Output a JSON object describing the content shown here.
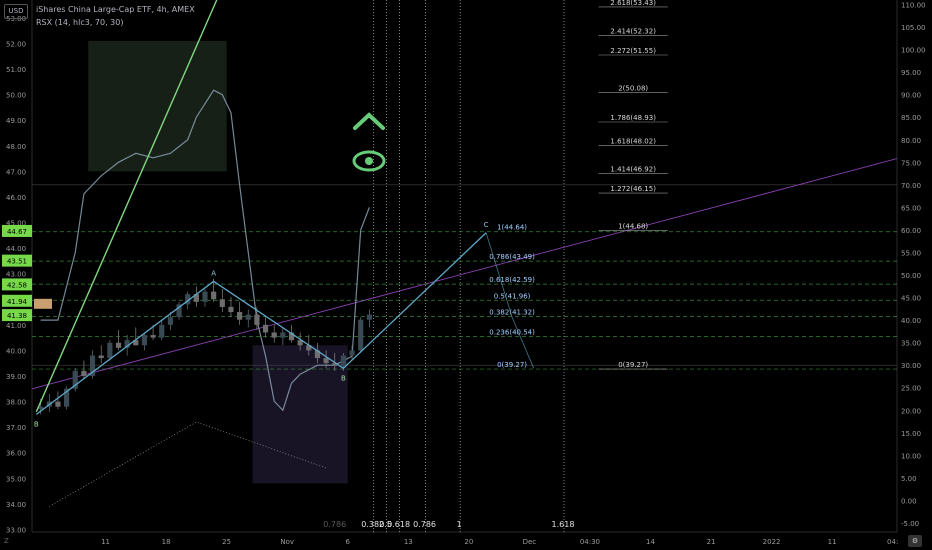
{
  "header": {
    "title": "iShares China Large-Cap ETF, 4h, AMEX",
    "indicator": "RSX (14, hlc3, 70, 30)",
    "currency": "USD"
  },
  "corner": {
    "zoom_label": "Z",
    "settings_icon": "gear-icon"
  },
  "colors": {
    "background": "#000000",
    "candle_up": "#3a4a55",
    "candle_down": "#6e6e6e",
    "trend_line": "#7fd87f",
    "wave": "#5fa8c8",
    "fib": "#3fa83f",
    "channel": "#8a3fb0",
    "rsx": "#8aa0b0",
    "badge": "#76d94a",
    "price_badge": "#c8a070"
  },
  "chart_data": {
    "type": "candlestick",
    "price_axis": {
      "ticks": [
        "53.00",
        "52.00",
        "51.00",
        "50.00",
        "49.00",
        "48.00",
        "47.00",
        "46.00",
        "45.00",
        "44.00",
        "43.00",
        "42.00",
        "41.00",
        "40.00",
        "39.00",
        "38.00",
        "37.00",
        "36.00",
        "35.00",
        "34.00",
        "33.00"
      ],
      "range": [
        32.9,
        53.7
      ]
    },
    "price_badges": [
      {
        "label": "44.67",
        "value": 44.67
      },
      {
        "label": "43.51",
        "value": 43.51
      },
      {
        "label": "42.58",
        "value": 42.58
      },
      {
        "label": "41.94",
        "value": 41.94
      },
      {
        "label": "41.38",
        "value": 41.38
      }
    ],
    "rsx_axis": {
      "ticks": [
        "110.00",
        "105.00",
        "100.00",
        "95.00",
        "90.00",
        "85.00",
        "80.00",
        "75.00",
        "70.00",
        "65.00",
        "60.00",
        "55.00",
        "50.00",
        "45.00",
        "40.00",
        "35.00",
        "30.00",
        "25.00",
        "20.00",
        "15.00",
        "10.00",
        "5.00",
        "0.00",
        "-5.00"
      ],
      "range": [
        -7,
        111
      ]
    },
    "time_axis": {
      "labels": [
        {
          "t": 8.5,
          "label": "11"
        },
        {
          "t": 15.5,
          "label": "18"
        },
        {
          "t": 22.5,
          "label": "25"
        },
        {
          "t": 29.5,
          "label": "Nov"
        },
        {
          "t": 36.5,
          "label": "6"
        },
        {
          "t": 43.5,
          "label": "13"
        },
        {
          "t": 50.5,
          "label": "20"
        },
        {
          "t": 57.5,
          "label": "Dec"
        },
        {
          "t": 64.5,
          "label": "04:30"
        },
        {
          "t": 71.5,
          "label": "14"
        },
        {
          "t": 78.5,
          "label": "21"
        },
        {
          "t": 85.5,
          "label": "2022"
        },
        {
          "t": 92.5,
          "label": "11"
        },
        {
          "t": 99.5,
          "label": "04:"
        }
      ]
    },
    "candles": [
      {
        "t": 1,
        "o": 37.7,
        "h": 38.1,
        "l": 37.5,
        "c": 37.8
      },
      {
        "t": 2,
        "o": 37.8,
        "h": 38.3,
        "l": 37.6,
        "c": 38.0
      },
      {
        "t": 3,
        "o": 38.0,
        "h": 38.4,
        "l": 37.7,
        "c": 37.8
      },
      {
        "t": 4,
        "o": 37.8,
        "h": 38.6,
        "l": 37.7,
        "c": 38.5
      },
      {
        "t": 5,
        "o": 38.5,
        "h": 39.3,
        "l": 38.4,
        "c": 39.2
      },
      {
        "t": 6,
        "o": 39.2,
        "h": 39.6,
        "l": 38.9,
        "c": 39.0
      },
      {
        "t": 7,
        "o": 39.0,
        "h": 40.0,
        "l": 38.9,
        "c": 39.8
      },
      {
        "t": 8,
        "o": 39.8,
        "h": 40.2,
        "l": 39.5,
        "c": 39.7
      },
      {
        "t": 9,
        "o": 39.7,
        "h": 40.4,
        "l": 39.6,
        "c": 40.3
      },
      {
        "t": 10,
        "o": 40.3,
        "h": 40.8,
        "l": 40.0,
        "c": 40.1
      },
      {
        "t": 11,
        "o": 40.1,
        "h": 40.6,
        "l": 39.8,
        "c": 40.4
      },
      {
        "t": 12,
        "o": 40.4,
        "h": 40.9,
        "l": 40.2,
        "c": 40.2
      },
      {
        "t": 13,
        "o": 40.2,
        "h": 40.7,
        "l": 40.0,
        "c": 40.6
      },
      {
        "t": 14,
        "o": 40.6,
        "h": 41.0,
        "l": 40.4,
        "c": 40.5
      },
      {
        "t": 15,
        "o": 40.5,
        "h": 41.2,
        "l": 40.4,
        "c": 41.0
      },
      {
        "t": 16,
        "o": 41.0,
        "h": 41.5,
        "l": 40.8,
        "c": 41.3
      },
      {
        "t": 17,
        "o": 41.3,
        "h": 41.9,
        "l": 41.2,
        "c": 41.8
      },
      {
        "t": 18,
        "o": 41.8,
        "h": 42.3,
        "l": 41.6,
        "c": 42.2
      },
      {
        "t": 19,
        "o": 42.2,
        "h": 42.5,
        "l": 41.7,
        "c": 41.9
      },
      {
        "t": 20,
        "o": 41.9,
        "h": 42.4,
        "l": 41.7,
        "c": 42.3
      },
      {
        "t": 21,
        "o": 42.3,
        "h": 42.8,
        "l": 41.9,
        "c": 42.0
      },
      {
        "t": 22,
        "o": 42.0,
        "h": 42.4,
        "l": 41.5,
        "c": 41.7
      },
      {
        "t": 23,
        "o": 41.7,
        "h": 42.1,
        "l": 41.3,
        "c": 41.5
      },
      {
        "t": 24,
        "o": 41.5,
        "h": 41.9,
        "l": 41.0,
        "c": 41.2
      },
      {
        "t": 25,
        "o": 41.2,
        "h": 41.6,
        "l": 40.9,
        "c": 41.4
      },
      {
        "t": 26,
        "o": 41.4,
        "h": 41.7,
        "l": 40.8,
        "c": 41.0
      },
      {
        "t": 27,
        "o": 41.0,
        "h": 41.3,
        "l": 40.5,
        "c": 40.7
      },
      {
        "t": 28,
        "o": 40.7,
        "h": 41.0,
        "l": 40.3,
        "c": 40.5
      },
      {
        "t": 29,
        "o": 40.5,
        "h": 40.9,
        "l": 40.2,
        "c": 40.7
      },
      {
        "t": 30,
        "o": 40.7,
        "h": 41.0,
        "l": 40.3,
        "c": 40.4
      },
      {
        "t": 31,
        "o": 40.4,
        "h": 40.7,
        "l": 40.0,
        "c": 40.2
      },
      {
        "t": 32,
        "o": 40.2,
        "h": 40.6,
        "l": 39.8,
        "c": 40.0
      },
      {
        "t": 33,
        "o": 40.0,
        "h": 40.3,
        "l": 39.5,
        "c": 39.7
      },
      {
        "t": 34,
        "o": 39.7,
        "h": 40.0,
        "l": 39.3,
        "c": 39.5
      },
      {
        "t": 35,
        "o": 39.5,
        "h": 39.9,
        "l": 39.2,
        "c": 39.4
      },
      {
        "t": 36,
        "o": 39.4,
        "h": 39.9,
        "l": 39.2,
        "c": 39.8
      },
      {
        "t": 37,
        "o": 39.8,
        "h": 40.2,
        "l": 39.6,
        "c": 40.0
      },
      {
        "t": 38,
        "o": 40.0,
        "h": 41.3,
        "l": 39.9,
        "c": 41.2
      },
      {
        "t": 39,
        "o": 41.2,
        "h": 41.6,
        "l": 40.9,
        "c": 41.4
      }
    ],
    "wave_points": [
      {
        "t": 0.5,
        "v": 37.5,
        "label": "B"
      },
      {
        "t": 21,
        "v": 42.7,
        "label": "A"
      },
      {
        "t": 36,
        "v": 39.3,
        "label": "B"
      },
      {
        "t": 52.5,
        "v": 44.6,
        "label": "C"
      }
    ],
    "fib_levels": [
      {
        "label": "2.618(53.43)",
        "value": 53.43
      },
      {
        "label": "2.414(52.32)",
        "value": 52.32
      },
      {
        "label": "2.272(51.55)",
        "value": 51.55
      },
      {
        "label": "2(50.08)",
        "value": 50.08
      },
      {
        "label": "1.786(48.93)",
        "value": 48.93
      },
      {
        "label": "1.618(48.02)",
        "value": 48.02
      },
      {
        "label": "1.414(46.92)",
        "value": 46.92
      },
      {
        "label": "1.272(46.15)",
        "value": 46.15
      },
      {
        "label": "1(44.68)",
        "value": 44.68
      },
      {
        "label": "0(39.27)",
        "value": 39.27
      }
    ],
    "retracement_levels": [
      {
        "label": "1(44.64)",
        "value": 44.64
      },
      {
        "label": "0.786(43.49)",
        "value": 43.49
      },
      {
        "label": "0.618(42.59)",
        "value": 42.59
      },
      {
        "label": "0.5(41.96)",
        "value": 41.96
      },
      {
        "label": "0.382(41.32)",
        "value": 41.32
      },
      {
        "label": "0.236(40.54)",
        "value": 40.54
      },
      {
        "label": "0(39.27)",
        "value": 39.27
      }
    ],
    "time_fib_lines": [
      {
        "t": 39.5,
        "label": "0.382"
      },
      {
        "t": 41,
        "label": "0.5"
      },
      {
        "t": 42.5,
        "label": "0.618"
      },
      {
        "t": 45.5,
        "label": "0.786"
      },
      {
        "t": 49.5,
        "label": "1"
      },
      {
        "t": 61.5,
        "label": "1.618"
      }
    ],
    "faded_label": "0.786",
    "rsx_series": [
      {
        "t": 1,
        "v": 40
      },
      {
        "t": 3,
        "v": 40
      },
      {
        "t": 5,
        "v": 55
      },
      {
        "t": 6,
        "v": 68
      },
      {
        "t": 8,
        "v": 72
      },
      {
        "t": 10,
        "v": 75
      },
      {
        "t": 12,
        "v": 77
      },
      {
        "t": 14,
        "v": 76
      },
      {
        "t": 16,
        "v": 77
      },
      {
        "t": 18,
        "v": 80
      },
      {
        "t": 19,
        "v": 85
      },
      {
        "t": 20,
        "v": 88
      },
      {
        "t": 21,
        "v": 91
      },
      {
        "t": 22,
        "v": 90
      },
      {
        "t": 23,
        "v": 86
      },
      {
        "t": 24,
        "v": 70
      },
      {
        "t": 25,
        "v": 55
      },
      {
        "t": 26,
        "v": 40
      },
      {
        "t": 27,
        "v": 32
      },
      {
        "t": 28,
        "v": 22
      },
      {
        "t": 29,
        "v": 20
      },
      {
        "t": 30,
        "v": 26
      },
      {
        "t": 31,
        "v": 28
      },
      {
        "t": 33,
        "v": 30
      },
      {
        "t": 35,
        "v": 30
      },
      {
        "t": 37,
        "v": 32
      },
      {
        "t": 38,
        "v": 60
      },
      {
        "t": 39,
        "v": 65
      }
    ],
    "rsx_levels": [
      70,
      30
    ]
  }
}
